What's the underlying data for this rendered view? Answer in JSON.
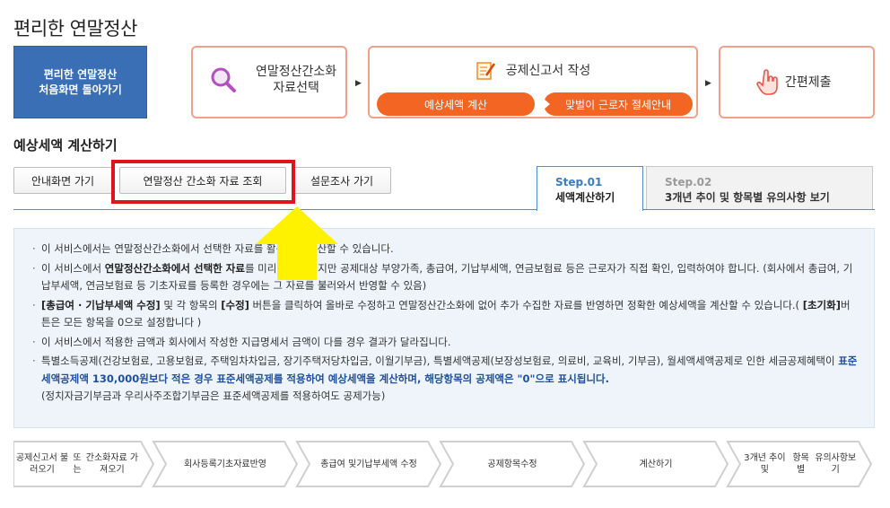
{
  "page_title": "편리한 연말정산",
  "home_button": {
    "line1": "편리한 연말정산",
    "line2": "처음화면 돌아가기"
  },
  "steps": {
    "step1": {
      "line1": "연말정산간소화",
      "line2": "자료선택",
      "icon": "magnifier-icon"
    },
    "step2": {
      "title": "공제신고서 작성",
      "icon": "form-pencil-icon",
      "pill1": "예상세액 계산",
      "pill2": "맞벌이 근로자 절세안내"
    },
    "step3": {
      "title": "간편제출",
      "icon": "hand-pointer-icon"
    }
  },
  "section_title": "예상세액 계산하기",
  "buttons": {
    "guide": "안내화면 가기",
    "inquiry": "연말정산 간소화 자료 조회",
    "survey": "설문조사 가기"
  },
  "tabs": [
    {
      "step": "Step.01",
      "name": "세액계산하기",
      "active": true
    },
    {
      "step": "Step.02",
      "name": "3개년 추이 및 항목별 유의사항 보기",
      "active": false
    }
  ],
  "info": {
    "item1": "이 서비스에서는 연말정산간소화에서 선택한 자료를 활용하여 계산할 수 있습니다.",
    "item2_pre": "이 서비스에서 ",
    "item2_bold": "연말정산간소화에서 선택한 자료",
    "item2_post": "를 미리 채워드리지만 공제대상 부양가족, 총급여, 기납부세액, 연금보험료 등은 근로자가 직접 확인, 입력하여야 합니다. (회사에서 총급여, 기납부세액, 연금보험료 등 기초자료를 등록한 경우에는 그 자료를 불러와서 반영할 수 있음)",
    "item3_b1": "[총급여 · 기납부세액 수정]",
    "item3_mid1": " 및 각 항목의 ",
    "item3_b2": "[수정]",
    "item3_mid2": " 버튼을 클릭하여 올바로 수정하고 연말정산간소화에 없어 추가 수집한 자료를 반영하면 정확한 예상세액을 계산할 수 있습니다.( ",
    "item3_b3": "[초기화]",
    "item3_post": "버튼은 모든 항목을 0으로 설정합니다 )",
    "item4": "이 서비스에서 적용한 금액과 회사에서 작성한 지급명세서 금액이 다를 경우 결과가 달라집니다.",
    "item5_pre": "특별소득공제(건강보험료, 고용보험료, 주택임차차입금, 장기주택저당차입금, 이월기부금), 특별세액공제(보장성보험료, 의료비, 교육비, 기부금), 월세액세액공제로 인한 세금공제혜택이 ",
    "item5_blue": "표준세액공제액 130,000원보다 적은 경우 표준세액공제를 적용하여 예상세액을 계산하며, 해당항목의 공제액은 \"0\"으로 표시됩니다.",
    "item5_post": "(정치자금기부금과 우리사주조합기부금은 표준세액공제를 적용하여도 공제가능)"
  },
  "flow": [
    {
      "lines": [
        "공제신고서 불러오기",
        "또는",
        "간소화자료 가져오기"
      ]
    },
    {
      "lines": [
        "회사등록",
        "기초자료반영"
      ]
    },
    {
      "lines": [
        "총급여 및",
        "기납부세액 수정"
      ]
    },
    {
      "lines": [
        "공제항목수정"
      ]
    },
    {
      "lines": [
        "계산하기"
      ]
    },
    {
      "lines": [
        "3개년 추이 및",
        "항목별",
        "유의사항보기"
      ]
    }
  ],
  "colors": {
    "accent_orange": "#f26522",
    "step_border": "#f3a08a",
    "home_blue": "#3a6fb5",
    "highlight_red": "#e0141b",
    "arrow_yellow": "#fff200",
    "tab_blue": "#4a8fd1"
  }
}
